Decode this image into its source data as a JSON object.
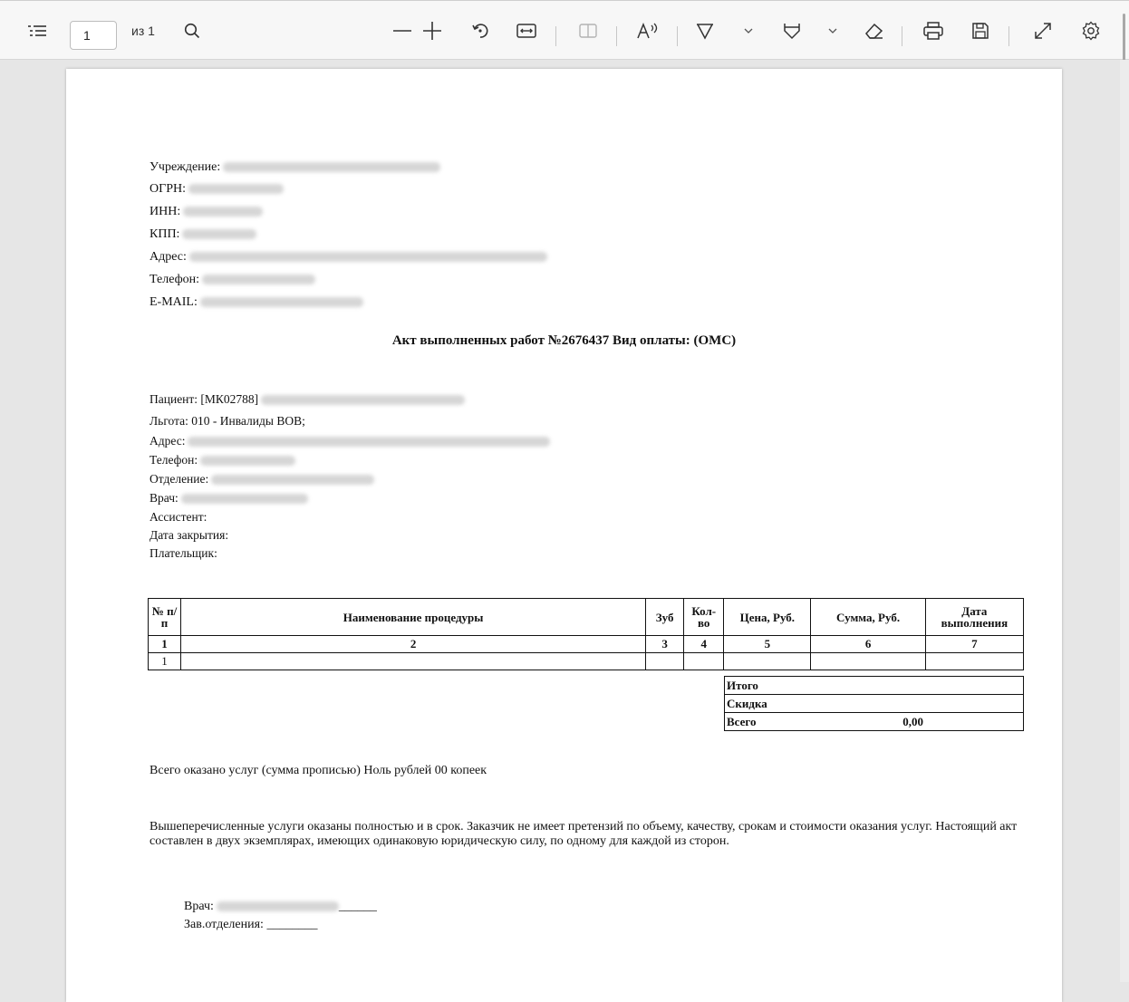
{
  "toolbar": {
    "page_number": "1",
    "page_of": "из 1"
  },
  "header": {
    "institution_label": "Учреждение:",
    "ogrn_label": "ОГРН:",
    "inn_label": "ИНН:",
    "kpp_label": "КПП:",
    "address_label": "Адрес:",
    "phone_label": "Телефон:",
    "email_label": "E-MAIL:"
  },
  "title": "Акт выполненных работ  №2676437 Вид оплаты: (ОМС)",
  "patient": {
    "patient_label": "Пациент: [МК02788]",
    "benefit": "Льгота: 010 - Инвалиды ВОВ;",
    "address_label": "Адрес:",
    "phone_label": "Телефон:",
    "department_label": "Отделение:",
    "doctor_label": "Врач:",
    "assistant_label": "Ассистент:",
    "closing_date_label": "Дата закрытия:",
    "payer_label": "Плательщик:"
  },
  "table": {
    "headers": [
      "№ п/п",
      "Наименование процедуры",
      "Зуб",
      "Кол-во",
      "Цена, Руб.",
      "Сумма, Руб.",
      "Дата выполнения"
    ],
    "column_numbers": [
      "1",
      "2",
      "3",
      "4",
      "5",
      "6",
      "7"
    ],
    "rows": [
      [
        "1",
        "",
        "",
        "",
        "",
        "",
        ""
      ]
    ]
  },
  "totals": {
    "subtotal_label": "Итого",
    "discount_label": "Скидка",
    "total_label": "Всего",
    "total_value": "0,00"
  },
  "sum_in_words": "Всего оказано услуг (сумма прописью) Ноль рублей 00 копеек",
  "statement": "Вышеперечисленные услуги оказаны полностью и в срок. Заказчик не имеет претензий по объему, качеству, срокам и стоимости оказания услуг. Настоящий акт составлен в двух экземплярах, имеющих одинаковую юридическую силу, по одному для каждой из сторон.",
  "signatures": {
    "doctor_label": "Врач:",
    "doctor_line": "______",
    "head_label": "Зав.отделения:",
    "head_line": "________"
  }
}
